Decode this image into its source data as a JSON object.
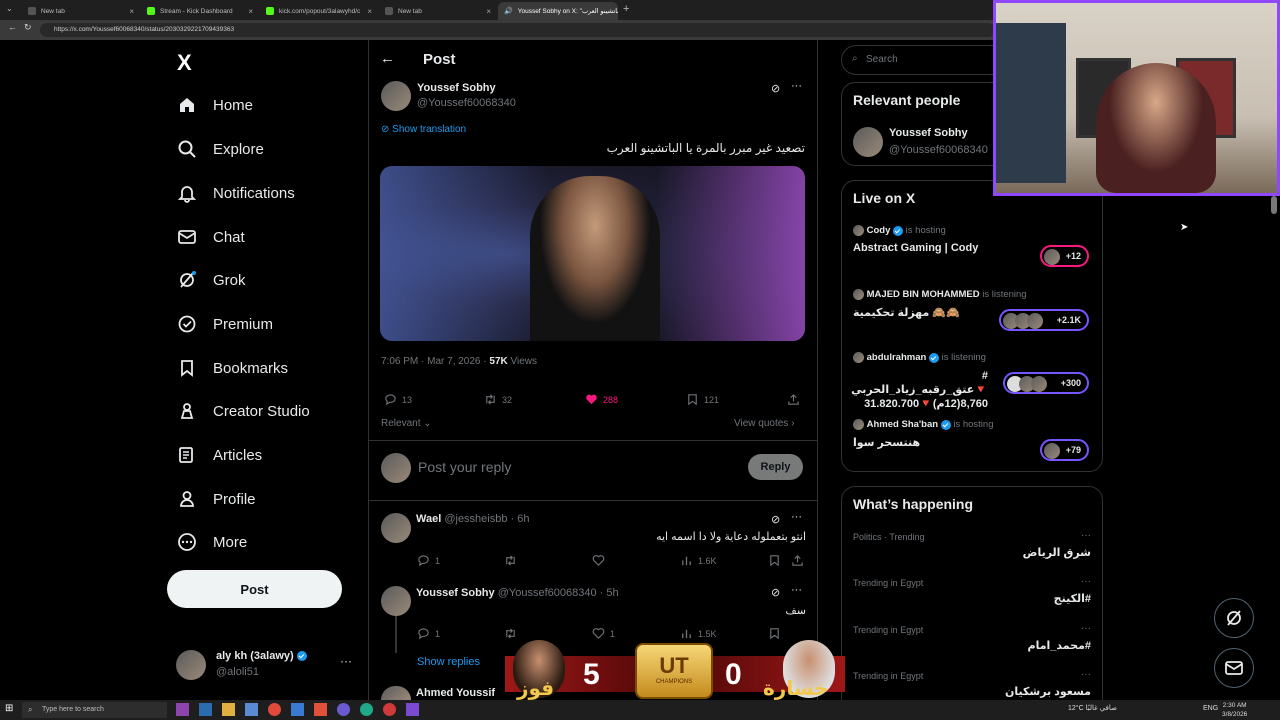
{
  "browser": {
    "tabs": [
      {
        "title": "New tab",
        "icon": "newtab-icon"
      },
      {
        "title": "Stream - Kick Dashboard",
        "icon": "kick-icon"
      },
      {
        "title": "kick.com/popout/3alawyhd/c",
        "icon": "kick-icon"
      },
      {
        "title": "New tab",
        "icon": "newtab-icon"
      },
      {
        "title": "Youssef Sobhy on X: \"تصعيد غير مبرر بالمرة يا الباتشينو العرب\"",
        "icon": "x-icon"
      }
    ],
    "url": "https://x.com/Youssef60068340/status/2030329221709439363"
  },
  "nav": {
    "logo": "X",
    "items": [
      "Home",
      "Explore",
      "Notifications",
      "Chat",
      "Grok",
      "Premium",
      "Bookmarks",
      "Creator Studio",
      "Articles",
      "Profile",
      "More"
    ],
    "post_button": "Post",
    "account_name": "aly kh (3alawy)",
    "account_handle": "@aloli51"
  },
  "post": {
    "header": "Post",
    "author_name": "Youssef Sobhy",
    "author_handle": "@Youssef60068340",
    "show_translation": "Show translation",
    "text": "تصعيد غير مبرر بالمرة يا الباتشينو العرب",
    "time": "7:06 PM · Mar 7, 2026 · ",
    "views_count": "57K",
    "views_label": " Views",
    "replies": "13",
    "reposts": "32",
    "likes": "288",
    "bookmarks": "121",
    "sort": "Relevant",
    "view_quotes": "View quotes",
    "reply_placeholder": "Post your reply",
    "reply_button": "Reply"
  },
  "replies": [
    {
      "name": "Wael",
      "handle": "@jessheisbb",
      "time": "· 6h",
      "text": "انتو بتعملوله دعاية ولا دا اسمه ايه",
      "replies": "1",
      "likes": "",
      "views": "1.6K"
    },
    {
      "name": "Youssef Sobhy",
      "handle": "@Youssef60068340",
      "time": "· 5h",
      "text": "سف",
      "replies": "1",
      "likes": "1",
      "views": "1.5K"
    }
  ],
  "show_replies": "Show replies",
  "next_reply_name": "Ahmed Youssif",
  "sidebar": {
    "search_placeholder": "Search",
    "relevant_title": "Relevant people",
    "relevant_name": "Youssef Sobhy",
    "relevant_handle": "@Youssef60068340",
    "live_title": "Live on X",
    "live": [
      {
        "host": "Cody",
        "status": "is hosting",
        "title": "Abstract Gaming | Cody",
        "count": "+12"
      },
      {
        "host": "MAJED BIN MOHAMMED",
        "status": "is listening",
        "title": "مهزلة تحكيمية 🙈🙈",
        "count": "+2.1K"
      },
      {
        "host": "abdulrahman",
        "status": "is listening",
        "title": "# 🔻عتق_رقبه_زياد_الحربي 8,760(12م)🔻31.820.700",
        "count": "+300"
      },
      {
        "host": "Ahmed Sha'ban",
        "status": "is hosting",
        "title": "هنتسحر سوا",
        "count": "+79"
      }
    ],
    "happening_title": "What’s happening",
    "trends": [
      {
        "context": "Politics · Trending",
        "name": "شرق الرياض"
      },
      {
        "context": "Trending in Egypt",
        "name": "#الكينج"
      },
      {
        "context": "Trending in Egypt",
        "name": "#محمد_امام"
      },
      {
        "context": "Trending in Egypt",
        "name": "مسعود برشكيان"
      }
    ]
  },
  "overlay": {
    "left_label": "فوز",
    "left_score": "5",
    "badge": "UT",
    "badge_sub": "CHAMPIONS",
    "right_score": "0",
    "right_label": "خسارة"
  },
  "taskbar": {
    "search": "Type here to search",
    "weather": "12°C",
    "weather_text": "صافي غالبًا",
    "lang": "ENG",
    "time": "2:30 AM",
    "date": "3/8/2026"
  },
  "colors": {
    "accent": "#1d9bf0",
    "like": "#f91880",
    "twitch": "#9146ff"
  }
}
